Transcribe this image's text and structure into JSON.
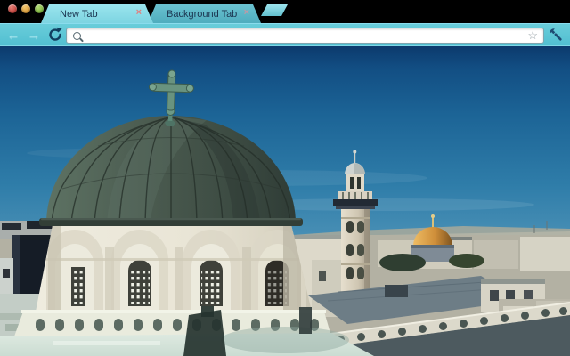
{
  "window": {
    "controls": [
      {
        "name": "close",
        "color": "#c4433d"
      },
      {
        "name": "minimize",
        "color": "#d99a39"
      },
      {
        "name": "zoom",
        "color": "#7cb53e"
      }
    ]
  },
  "tab_strip": {
    "tabs": [
      {
        "label": "New Tab",
        "state": "active",
        "close_glyph": "×"
      },
      {
        "label": "Background Tab",
        "state": "background",
        "close_glyph": "×"
      }
    ],
    "new_tab_button": {
      "icon": "new-tab-button"
    }
  },
  "toolbar": {
    "back": {
      "icon": "back-arrow-icon",
      "glyph": "←",
      "enabled": false
    },
    "forward": {
      "icon": "forward-arrow-icon",
      "glyph": "→",
      "enabled": false
    },
    "reload": {
      "icon": "reload-icon"
    },
    "omnibox": {
      "value": "",
      "left_icon": "search-magnifier-icon",
      "right_icon": "bookmark-star-icon",
      "star_glyph": "☆"
    },
    "menu": {
      "icon": "wrench-icon"
    }
  },
  "theme": {
    "frame_teal": "#2b7787",
    "toolbar_teal": "#5cc5d6",
    "active_tab": "#8edde9",
    "background_tab": "#58b4c4",
    "tab_text": "#1b3550",
    "photo_sky_top": "#0d3c71",
    "photo_sky_horizon": "#8db8cb",
    "church_dome_verdigris": "#46584d",
    "rock_dome_gold": "#cf8f3a"
  },
  "content": {
    "type": "photograph",
    "description": "Rooftop view of Jerusalem Old City: weathered verdigris church dome topped with a cross in the foreground, a stone minaret and the golden Dome of the Rock beyond, white stone rooftops below a clear blue sky"
  }
}
